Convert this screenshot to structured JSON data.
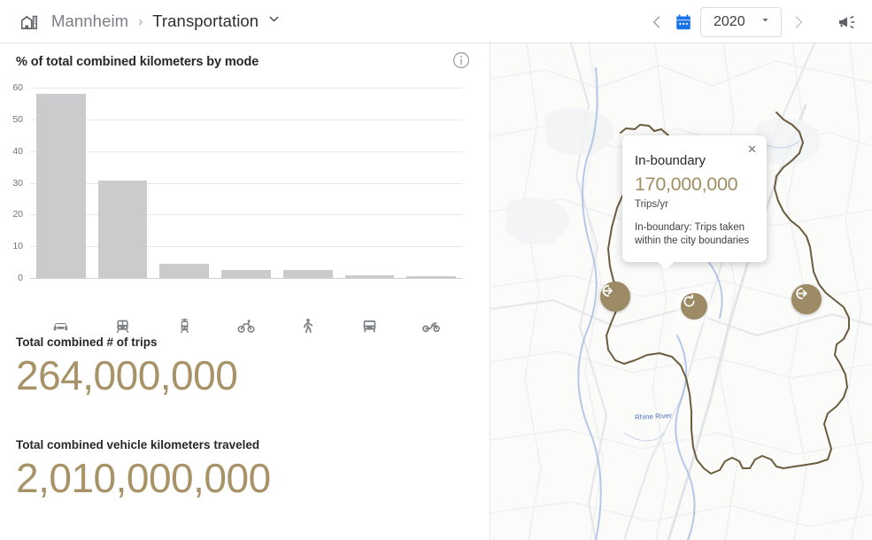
{
  "header": {
    "city_icon": "city-buildings-icon",
    "breadcrumb_city": "Mannheim",
    "breadcrumb_separator": "›",
    "breadcrumb_section": "Transportation",
    "section_caret": "⌄",
    "prev_label": "‹",
    "next_label": "›",
    "calendar_icon": "calendar-icon",
    "year": "2020",
    "year_caret": "▾",
    "feedback_icon": "megaphone-icon"
  },
  "chart_panel": {
    "title": "% of total combined kilometers by mode",
    "info_icon": "info-icon"
  },
  "chart_data": {
    "type": "bar",
    "title": "% of total combined kilometers by mode",
    "xlabel": "",
    "ylabel": "",
    "ylim": [
      0,
      60
    ],
    "yticks": [
      "0",
      "10",
      "20",
      "30",
      "40",
      "50",
      "60"
    ],
    "grid": true,
    "legend": "none",
    "categories": [
      "Car",
      "Train",
      "Tram",
      "Bicycle",
      "Walking",
      "Bus",
      "Motorcycle"
    ],
    "category_icons": [
      "car-icon",
      "train-icon",
      "tram-icon",
      "bicycle-icon",
      "pedestrian-icon",
      "bus-icon",
      "motorcycle-icon"
    ],
    "values": [
      58.0,
      30.6,
      4.6,
      2.6,
      2.6,
      0.9,
      0.5
    ],
    "bar_color": "#c9cbcd"
  },
  "stats": [
    {
      "label": "Total combined # of trips",
      "value": "264,000,000"
    },
    {
      "label": "Total combined vehicle kilometers traveled",
      "value": "2,010,000,000"
    }
  ],
  "map": {
    "river_label": "Rhine River",
    "markers": [
      {
        "name": "inbound",
        "icon": "arrow-into-circle-icon",
        "selected": false
      },
      {
        "name": "in-boundary",
        "icon": "circular-arrow-icon",
        "selected": true
      },
      {
        "name": "outbound",
        "icon": "arrow-out-of-circle-icon",
        "selected": false
      }
    ],
    "popup": {
      "close_label": "✕",
      "title": "In-boundary",
      "value": "170,000,000",
      "unit": "Trips/yr",
      "description": "In-boundary: Trips taken within the city boundaries"
    }
  },
  "colors": {
    "accent_gold": "#a89368",
    "marker_gold": "#9c8b64",
    "bar_gray": "#c9cbcd",
    "boundary": "#6b5c3e"
  }
}
